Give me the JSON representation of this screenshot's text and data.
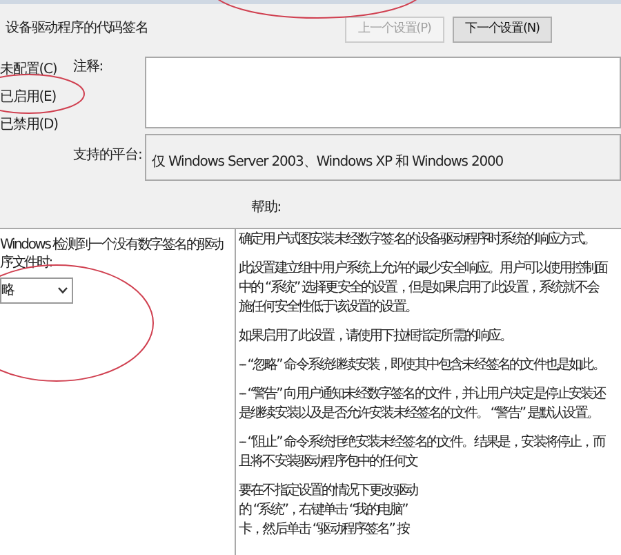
{
  "header": {
    "title": "设备驱动程序的代码签名"
  },
  "nav_buttons": [
    {
      "label": "上一个设置(P)",
      "disabled": true
    },
    {
      "label": "下一个设置(N)",
      "disabled": false
    }
  ],
  "state_options": [
    "未配置(C)",
    "已启用(E)",
    "已禁用(D)"
  ],
  "comment": {
    "label": "注释:"
  },
  "platform": {
    "label": "支持的平台:",
    "value": "仅 Windows Server 2003、Windows XP 和 Windows 2000"
  },
  "help_label": "帮助:",
  "options_panel": {
    "lines": [
      "Windows 检测到一个没有数字签名的驱动",
      "序文件时:"
    ],
    "dropdown_value": "略"
  },
  "help_paragraphs": [
    [
      "确定用户试图安装未经数字签名的设备驱动程序时系统的响应方式。"
    ],
    [
      "此设置建立组中用户系统上允许的最少安全响应。用户可以使用控制面",
      "中的 “系统” 选择更安全的设置，但是如果启用了此设置，系统就不会",
      "施任何安全性低于该设置的设置。"
    ],
    [
      "如果启用了此设置，请使用下拉框指定所需的响应。"
    ],
    [
      "-- “忽略” 命令系统继续安装，即使其中包含未经签名的文件也是如此。"
    ],
    [
      "-- “警告” 向用户通知未经数字签名的文件，并让用户决定是停止安装还",
      "是继续安装以及是否允许安装未经签名的文件。 “警告” 是默认设置。"
    ],
    [
      "-- “阻止” 命令系统拒绝安装未经签名的文件。结果是，安装将停止，而",
      "且将不安装驱动程序包中的任何文"
    ],
    [
      "要在不指定设置的情况下更改驱动",
      "的 “系统”，右键单击 “我的电脑”",
      "卡，然后单击 “驱动程序签名” 按"
    ]
  ]
}
